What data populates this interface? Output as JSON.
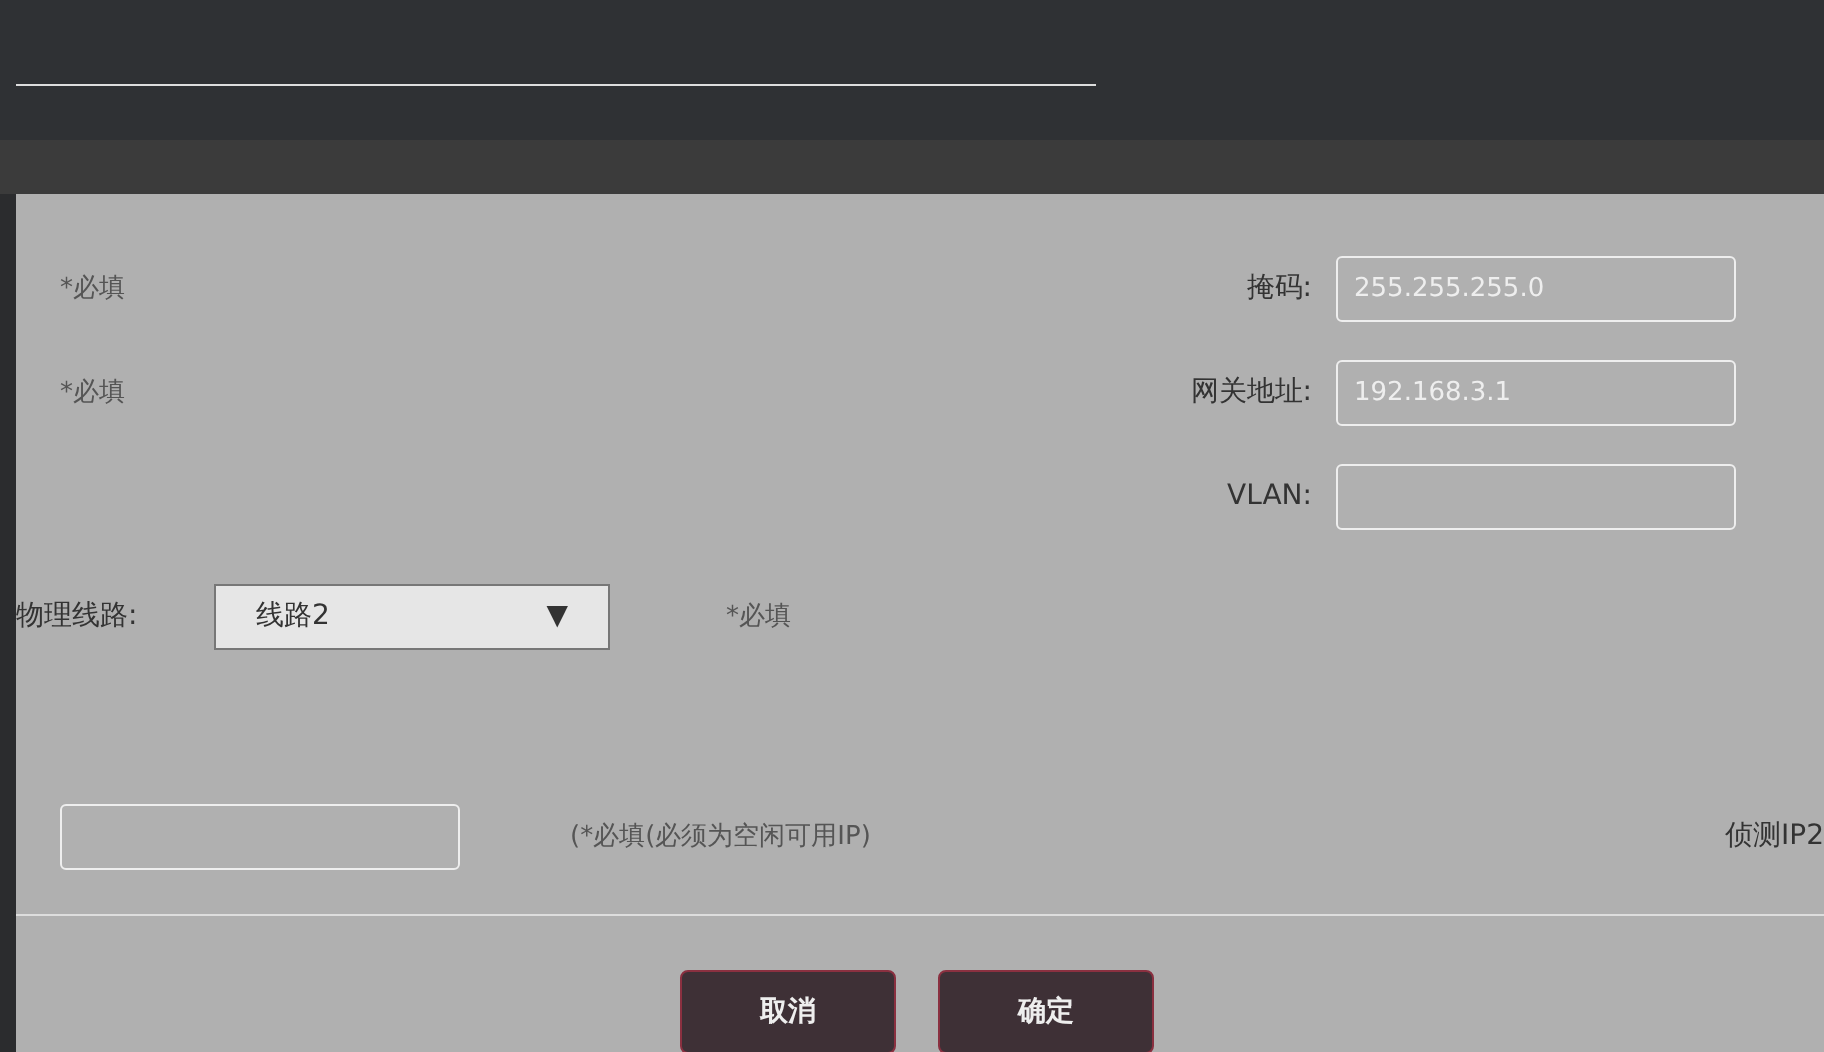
{
  "network_rows": [
    {
      "note": "*必填",
      "label": "掩码:",
      "value": "255.255.255.0"
    },
    {
      "note": "*必填",
      "label": "网关地址:",
      "value": "192.168.3.1"
    },
    {
      "label": "VLAN:"
    }
  ],
  "line_select": {
    "label": "物理线路:",
    "value": "线路2",
    "arrow": "▼",
    "note": "*必填"
  },
  "probe": {
    "note": "(*必填(必须为空闲可用IP)",
    "label": "侦测IP2"
  },
  "buttons": [
    "取消",
    "确定"
  ]
}
